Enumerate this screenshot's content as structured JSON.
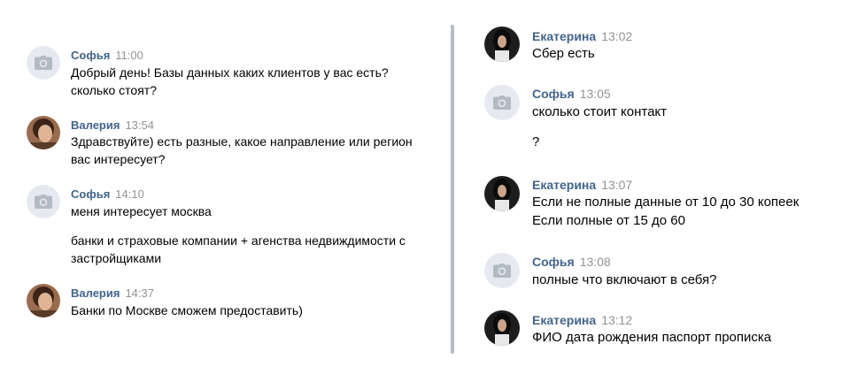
{
  "left": [
    {
      "name": "Софья",
      "time": "11:00",
      "lines": [
        "Добрый день! Базы данных каких клиентов у вас есть?",
        "сколько стоят?"
      ]
    },
    {
      "name": "Валерия",
      "time": "13:54",
      "lines": [
        "Здравствуйте) есть разные, какое направление или регион",
        "вас интересует?"
      ]
    },
    {
      "name": "Софья",
      "time": "14:10",
      "lines": [
        "меня интересует москва",
        "банки и страховые компании + агенства недвиждимости с",
        "застройщиками"
      ]
    },
    {
      "name": "Валерия",
      "time": "14:37",
      "lines": [
        "Банки по Москве сможем предоставить)"
      ]
    }
  ],
  "right": [
    {
      "name": "Екатерина",
      "time": "13:02",
      "lines": [
        "Сбер есть"
      ]
    },
    {
      "name": "Софья",
      "time": "13:05",
      "lines": [
        "сколько стоит контакт",
        "?"
      ]
    },
    {
      "name": "Екатерина",
      "time": "13:07",
      "lines": [
        "Если не полные данные от 10 до 30 копеек",
        "Если полные от 15 до 60"
      ]
    },
    {
      "name": "Софья",
      "time": "13:08",
      "lines": [
        "полные что включают в себя?"
      ]
    },
    {
      "name": "Екатерина",
      "time": "13:12",
      "lines": [
        "ФИО дата рождения паспорт прописка"
      ]
    }
  ],
  "icons": {
    "placeholder_avatar": "camera-icon",
    "avatar_bg": "#e6eaf0",
    "avatar_icon_color": "#b2bac4"
  },
  "colors": {
    "name": "#42648b",
    "time": "#939393",
    "divider": "#b5bcc6"
  }
}
